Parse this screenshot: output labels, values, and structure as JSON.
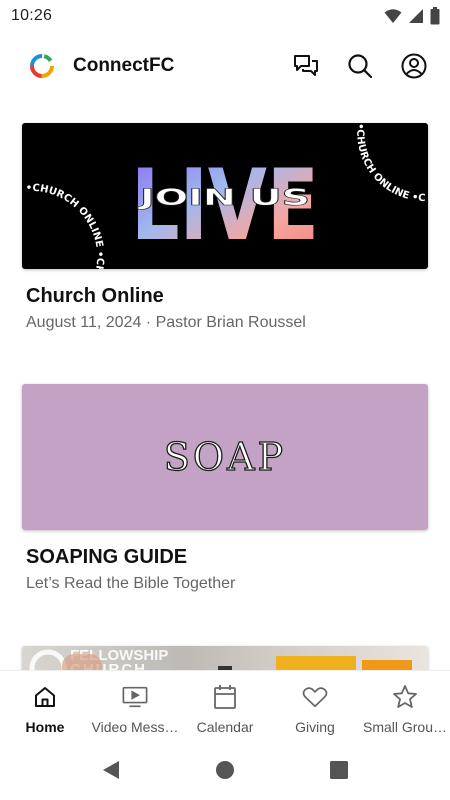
{
  "status_bar": {
    "time": "10:26",
    "icons": [
      "wifi-icon",
      "signal-icon",
      "battery-icon"
    ]
  },
  "header": {
    "app_name": "ConnectFC",
    "logo": "connectfc-logo",
    "actions": [
      "chat-icon",
      "search-icon",
      "account-icon"
    ]
  },
  "feed": {
    "items": [
      {
        "title": "Church Online",
        "subtitle": "August 11, 2024 · Pastor Brian Roussel",
        "image": {
          "headline": "LIVE",
          "overlay": "JOIN US",
          "arc_text": "•CHURCH ONLINE •CHURCH ONLINE•"
        }
      },
      {
        "title": "SOAPING GUIDE",
        "subtitle": "Let’s Read the Bible Together",
        "image": {
          "headline": "SOAP"
        }
      },
      {
        "title": "",
        "subtitle": "",
        "image": {
          "headline": "FELLOWSHIP",
          "subline": "CHURCH"
        }
      }
    ]
  },
  "bottom_nav": {
    "active": "Home",
    "items": [
      {
        "label": "Home",
        "icon": "home-icon"
      },
      {
        "label": "Video Mess…",
        "icon": "video-icon"
      },
      {
        "label": "Calendar",
        "icon": "calendar-icon"
      },
      {
        "label": "Giving",
        "icon": "heart-icon"
      },
      {
        "label": "Small Grou…",
        "icon": "star-icon"
      }
    ]
  },
  "colors": {
    "soap_background": "#c4a2c6",
    "live_gradient": [
      "#8b6cf2",
      "#9fb8f0",
      "#f5a7a0",
      "#f2807a"
    ],
    "text_primary": "#111111",
    "text_secondary": "#666666"
  }
}
